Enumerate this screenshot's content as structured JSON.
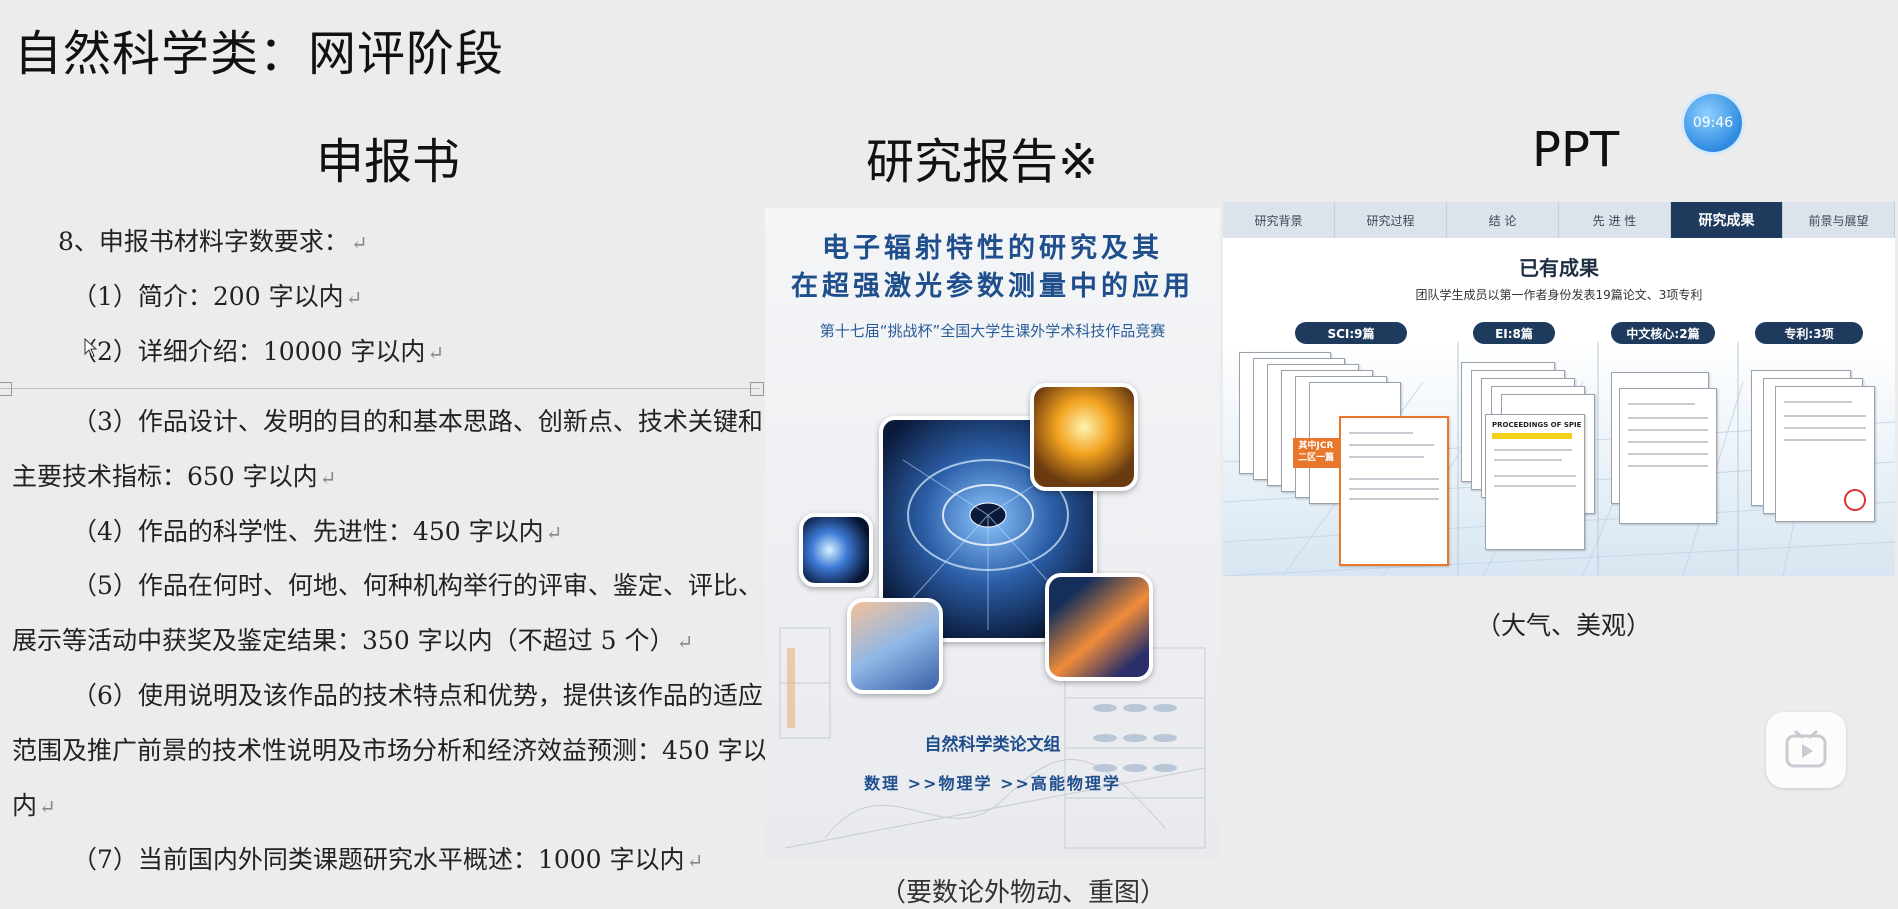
{
  "slide": {
    "title": "自然科学类：网评阶段",
    "timer": "09:46"
  },
  "columns": [
    {
      "heading": "申报书"
    },
    {
      "heading": "研究报告※"
    },
    {
      "heading": "PPT"
    }
  ],
  "application_doc": {
    "lines": [
      "8、申报书材料字数要求：",
      "（1）简介：200 字以内",
      "（2）详细介绍：10000 字以内",
      "（3）作品设计、发明的目的和基本思路、创新点、技术关键和",
      "主要技术指标：650 字以内",
      "（4）作品的科学性、先进性：450 字以内",
      "（5）作品在何时、何地、何种机构举行的评审、鉴定、评比、",
      "展示等活动中获奖及鉴定结果：350 字以内（不超过 5 个）",
      "（6）使用说明及该作品的技术特点和优势，提供该作品的适应",
      "范围及推广前景的技术性说明及市场分析和经济效益预测：450 字以",
      "内",
      "（7）当前国内外同类课题研究水平概述：1000 字以内"
    ],
    "return_mark": "↵"
  },
  "report_cover": {
    "title_line1": "电子辐射特性的研究及其",
    "title_line2": "在超强激光参数测量中的应用",
    "competition": "第十七届“挑战杯”全国大学生课外学术科技作品竞赛",
    "group": "自然科学类论文组",
    "path": "数理 >>物理学 >>高能物理学",
    "caption": "（要数论外物动、重图）"
  },
  "ppt_slide": {
    "tabs": [
      "研究背景",
      "研究过程",
      "结 论",
      "先 进 性",
      "研究成果",
      "前景与展望"
    ],
    "active_tab": 4,
    "title": "已有成果",
    "subtitle": "团队学生成员以第一作者身份发表19篇论文、3项专利",
    "pills": [
      "SCI:9篇",
      "EI:8篇",
      "中文核心:2篇",
      "专利:3项"
    ],
    "badge": "其中JCR 二区一篇",
    "spie_label": "PROCEEDINGS OF SPIE",
    "caption": "（大气、美观）"
  },
  "colors": {
    "background": "#ececed",
    "cover_title": "#1f4e8c",
    "ppt_navy": "#1e3a5c",
    "badge_orange": "#e8762b"
  }
}
